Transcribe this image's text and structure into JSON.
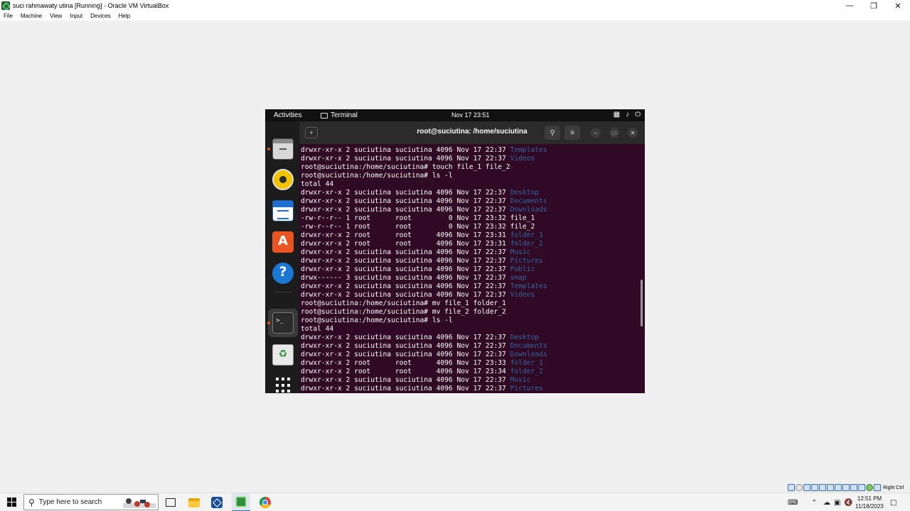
{
  "vbox": {
    "title": "suci rahmawaty utina [Running] - Oracle VM VirtualBox",
    "menu": [
      "File",
      "Machine",
      "View",
      "Input",
      "Devices",
      "Help"
    ],
    "host_key": "Right Ctrl"
  },
  "gnome": {
    "activities": "Activities",
    "app_name": "Terminal",
    "clock": "Nov 17  23:51"
  },
  "terminal": {
    "title": "root@suciutina: /home/suciutina",
    "lines": [
      {
        "text": "drwxr-xr-x 2 suciutina suciutina 4096 Nov 17 22:37 ",
        "dir": "Templates"
      },
      {
        "text": "drwxr-xr-x 2 suciutina suciutina 4096 Nov 17 22:37 ",
        "dir": "Videos"
      },
      {
        "text": "root@suciutina:/home/suciutina# touch file_1 file_2",
        "dir": ""
      },
      {
        "text": "root@suciutina:/home/suciutina# ls -l",
        "dir": ""
      },
      {
        "text": "total 44",
        "dir": ""
      },
      {
        "text": "drwxr-xr-x 2 suciutina suciutina 4096 Nov 17 22:37 ",
        "dir": "Desktop"
      },
      {
        "text": "drwxr-xr-x 2 suciutina suciutina 4096 Nov 17 22:37 ",
        "dir": "Documents"
      },
      {
        "text": "drwxr-xr-x 2 suciutina suciutina 4096 Nov 17 22:37 ",
        "dir": "Downloads"
      },
      {
        "text": "-rw-r--r-- 1 root      root         0 Nov 17 23:32 file_1",
        "dir": ""
      },
      {
        "text": "-rw-r--r-- 1 root      root         0 Nov 17 23:32 file_2",
        "dir": ""
      },
      {
        "text": "drwxr-xr-x 2 root      root      4096 Nov 17 23:31 ",
        "dir": "folder_1"
      },
      {
        "text": "drwxr-xr-x 2 root      root      4096 Nov 17 23:31 ",
        "dir": "folder_2"
      },
      {
        "text": "drwxr-xr-x 2 suciutina suciutina 4096 Nov 17 22:37 ",
        "dir": "Music"
      },
      {
        "text": "drwxr-xr-x 2 suciutina suciutina 4096 Nov 17 22:37 ",
        "dir": "Pictures"
      },
      {
        "text": "drwxr-xr-x 2 suciutina suciutina 4096 Nov 17 22:37 ",
        "dir": "Public"
      },
      {
        "text": "drwx------ 3 suciutina suciutina 4096 Nov 17 22:37 ",
        "dir": "snap"
      },
      {
        "text": "drwxr-xr-x 2 suciutina suciutina 4096 Nov 17 22:37 ",
        "dir": "Templates"
      },
      {
        "text": "drwxr-xr-x 2 suciutina suciutina 4096 Nov 17 22:37 ",
        "dir": "Videos"
      },
      {
        "text": "root@suciutina:/home/suciutina# mv file_1 folder_1",
        "dir": ""
      },
      {
        "text": "root@suciutina:/home/suciutina# mv file_2 folder_2",
        "dir": ""
      },
      {
        "text": "root@suciutina:/home/suciutina# ls -l",
        "dir": ""
      },
      {
        "text": "total 44",
        "dir": ""
      },
      {
        "text": "drwxr-xr-x 2 suciutina suciutina 4096 Nov 17 22:37 ",
        "dir": "Desktop"
      },
      {
        "text": "drwxr-xr-x 2 suciutina suciutina 4096 Nov 17 22:37 ",
        "dir": "Documents"
      },
      {
        "text": "drwxr-xr-x 2 suciutina suciutina 4096 Nov 17 22:37 ",
        "dir": "Downloads"
      },
      {
        "text": "drwxr-xr-x 2 root      root      4096 Nov 17 23:33 ",
        "dir": "folder_1"
      },
      {
        "text": "drwxr-xr-x 2 root      root      4096 Nov 17 23:34 ",
        "dir": "folder_2"
      },
      {
        "text": "drwxr-xr-x 2 suciutina suciutina 4096 Nov 17 22:37 ",
        "dir": "Music"
      },
      {
        "text": "drwxr-xr-x 2 suciutina suciutina 4096 Nov 17 22:37 ",
        "dir": "Pictures"
      }
    ]
  },
  "taskbar": {
    "search_placeholder": "Type here to search",
    "time": "12:51 PM",
    "date": "11/18/2023"
  },
  "colors": {
    "terminal_bg": "#300a24",
    "directory_blue": "#3465a4",
    "ubuntu_orange": "#e95420"
  }
}
